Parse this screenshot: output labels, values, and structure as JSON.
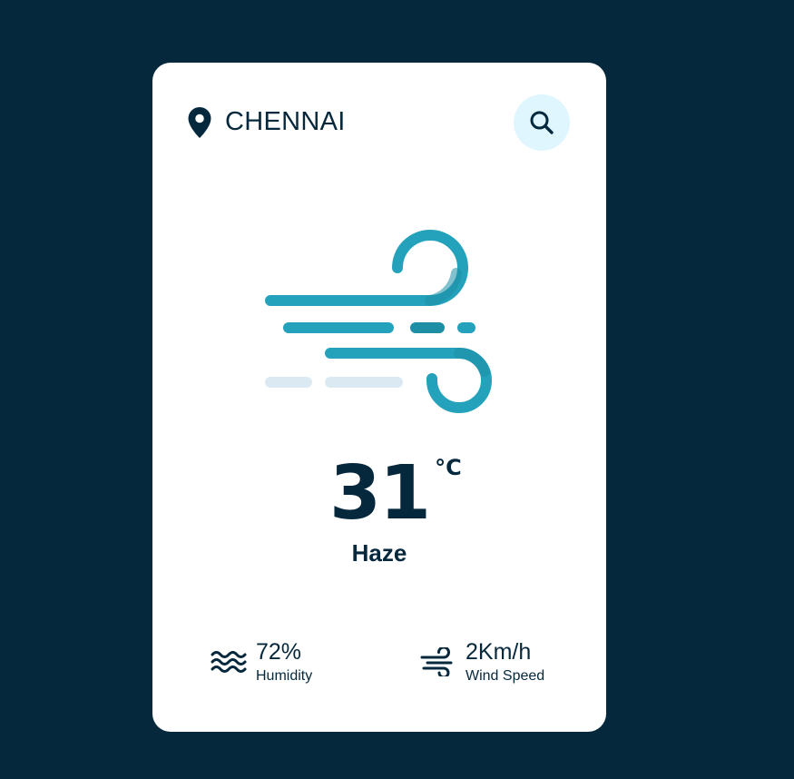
{
  "location": {
    "icon": "map-pin-icon",
    "city": "CHENNAI"
  },
  "search": {
    "icon": "search-icon"
  },
  "weather": {
    "icon": "wind-haze-icon",
    "temperature": "31",
    "unit": "°C",
    "description": "Haze"
  },
  "details": {
    "humidity": {
      "icon": "waves-icon",
      "value": "72%",
      "label": "Humidity"
    },
    "wind": {
      "icon": "wind-icon",
      "value": "2Km/h",
      "label": "Wind Speed"
    }
  },
  "colors": {
    "background": "#06283d",
    "card": "#ffffff",
    "text": "#06283d",
    "search_bg": "#dff6ff",
    "accent": "#24a2bb",
    "accent_dark": "#1e8ea5",
    "accent_light": "#dbeaf2"
  }
}
